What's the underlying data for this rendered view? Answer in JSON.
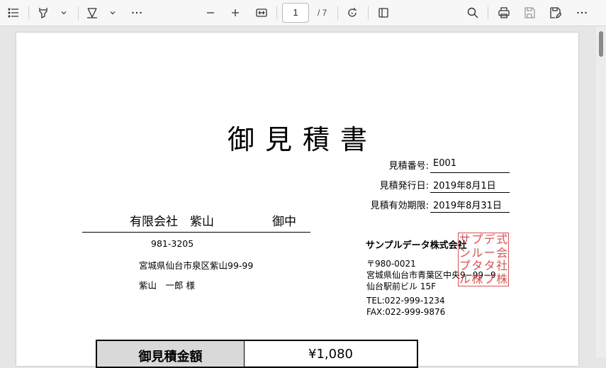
{
  "viewer": {
    "current_page": "1",
    "total_pages": "/ 7"
  },
  "document": {
    "title": "御見積書",
    "meta": [
      {
        "label": "見積番号:",
        "value": "E001"
      },
      {
        "label": "見積発行日:",
        "value": "2019年8月1日"
      },
      {
        "label": "見積有効期限:",
        "value": "2019年8月31日"
      }
    ],
    "recipient": {
      "name": "有限会社　紫山",
      "honorific": "御中",
      "postal": "981-3205",
      "address": "宮城県仙台市泉区紫山99-99",
      "person": "紫山　一郎 様"
    },
    "issuer": {
      "company": "サンプルデータ株式会社",
      "postal": "〒980-0021",
      "address1": "宮城県仙台市青葉区中央9−99−9",
      "address2": "仙台駅前ビル 15F",
      "tel": "TEL:022-999-1234",
      "fax": "FAX:022-999-9876"
    },
    "stamp": [
      "サ",
      "プ",
      "デ",
      "式",
      "ン",
      "ル",
      "ー",
      "会",
      "プ",
      "タ",
      "タ",
      "社",
      "ル",
      "株",
      "ブ",
      "株"
    ],
    "amount": {
      "label": "御見積金額",
      "value": "¥1,080"
    }
  }
}
